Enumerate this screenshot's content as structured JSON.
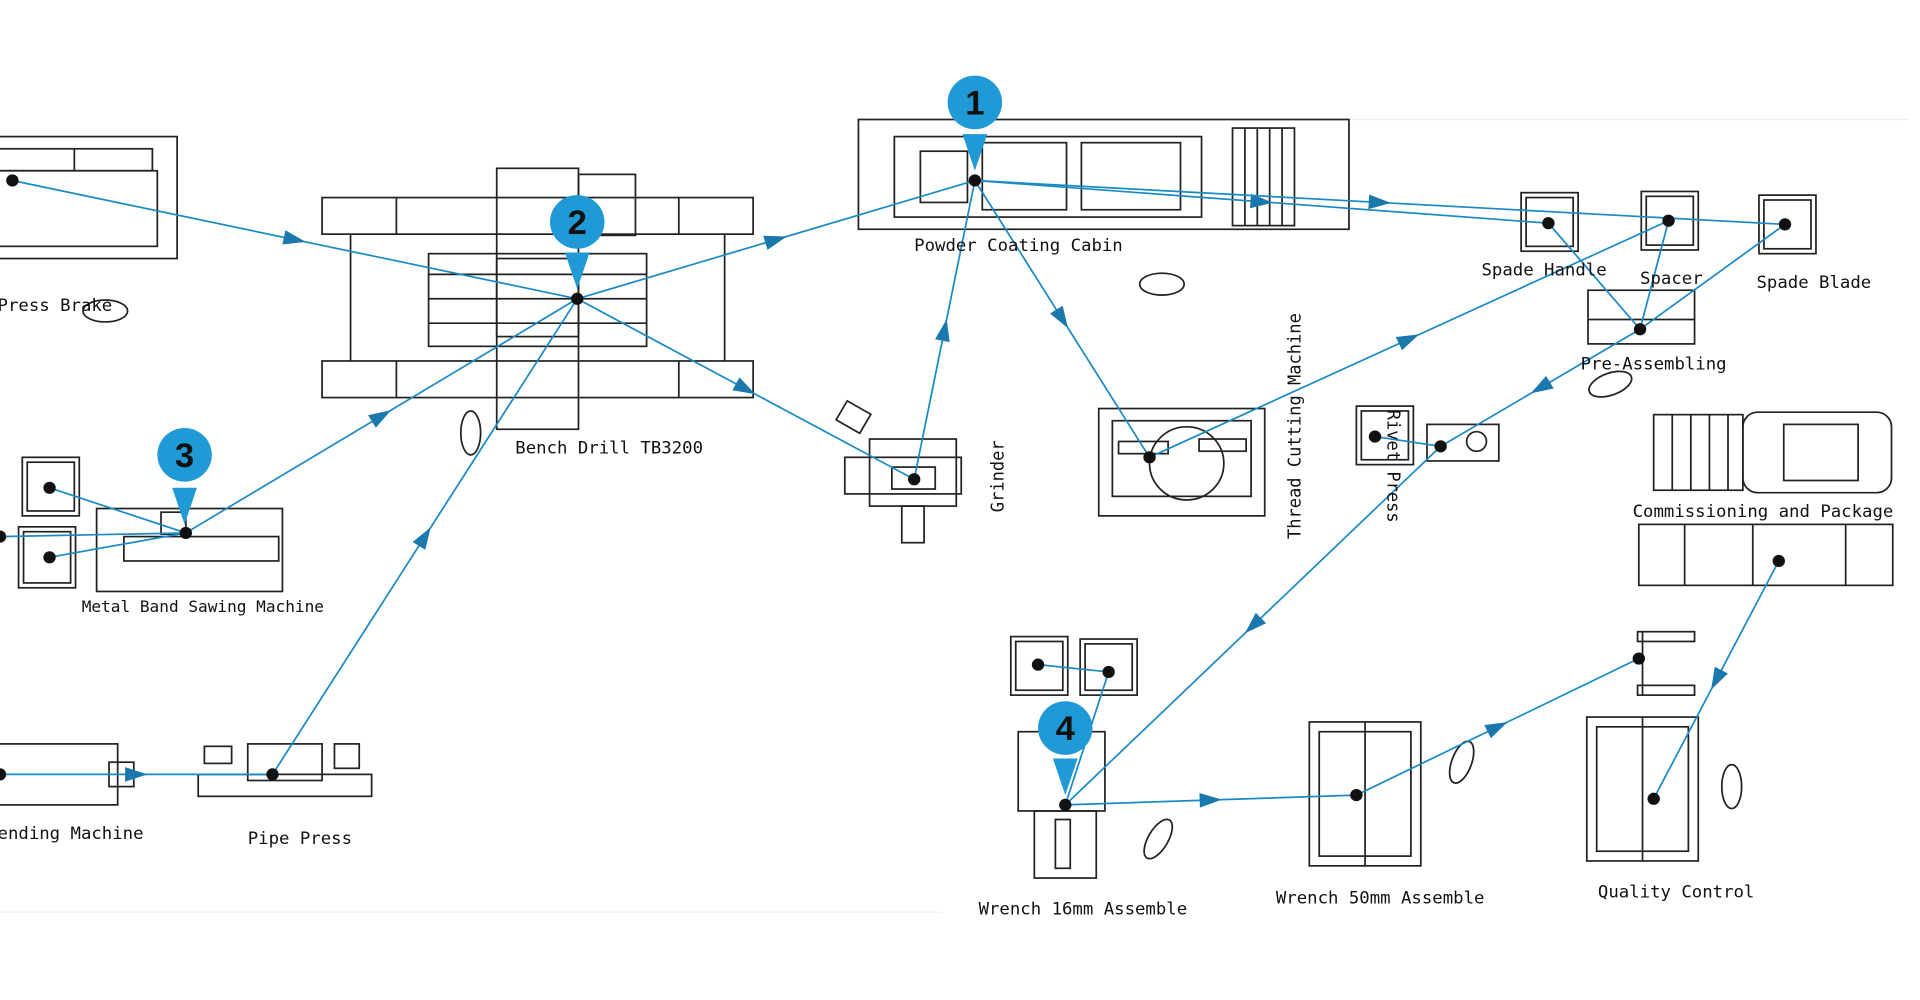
{
  "labels": {
    "press_brake": "Press Brake",
    "bench_drill": "Bench Drill TB3200",
    "powder_coating": "Powder Coating Cabin",
    "grinder": "Grinder",
    "thread_cutting": "Thread Cutting Machine",
    "spade_handle": "Spade Handle",
    "spacer": "Spacer",
    "spade_blade": "Spade Blade",
    "pre_assembling": "Pre-Assembling",
    "rivet_press": "Rivet Press",
    "commissioning": "Commissioning and Package",
    "metal_band_saw": "Metal Band Sawing Machine",
    "bending_machine": "ending Machine",
    "pipe_press": "Pipe Press",
    "wrench_16": "Wrench 16mm Assemble",
    "wrench_50": "Wrench 50mm Assemble",
    "quality_control": "Quality Control"
  },
  "markers": [
    "1",
    "2",
    "3",
    "4"
  ],
  "colors": {
    "flow": "#1a8ac4",
    "marker": "#1f9ad6"
  }
}
